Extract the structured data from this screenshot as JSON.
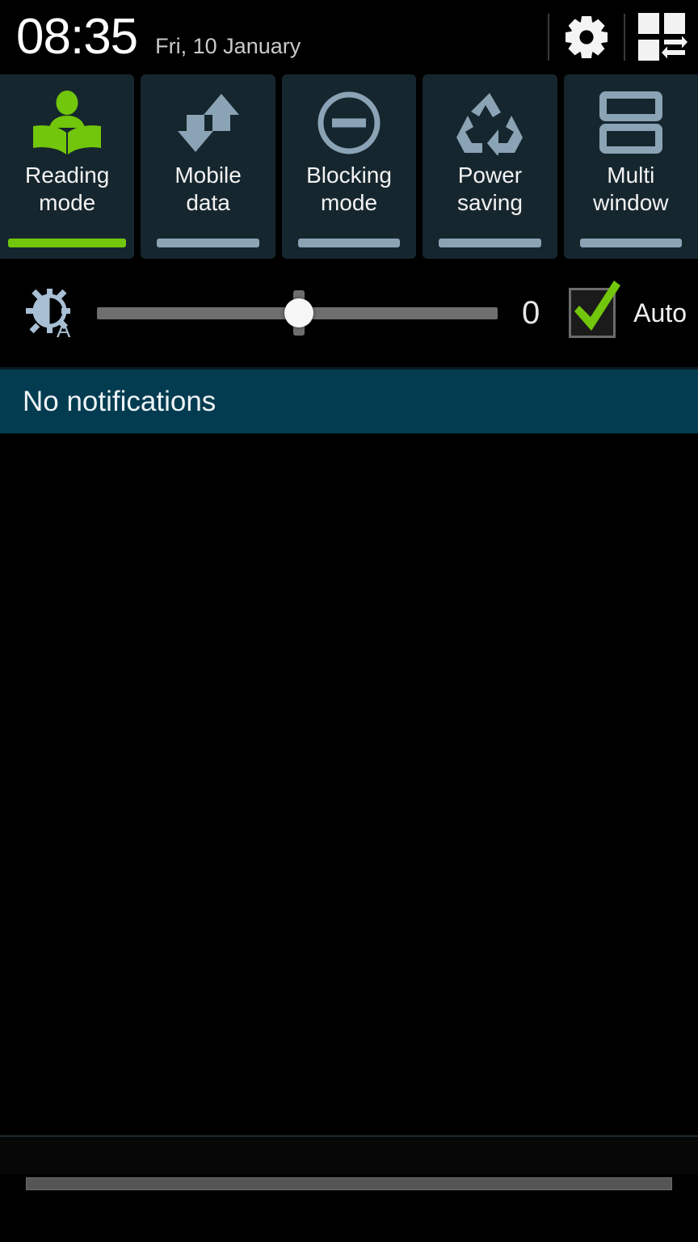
{
  "statusbar": {
    "time": "08:35",
    "date": "Fri, 10 January",
    "settings_icon": "gear-icon",
    "quick_settings_icon": "quick-settings-grid-icon"
  },
  "quick_toggles": [
    {
      "label": "Reading\nmode",
      "label_line1": "Reading",
      "label_line2": "mode",
      "icon": "reading-person-book-icon",
      "state": "on",
      "indicator_color": "#72c60b",
      "icon_color": "#72c60b"
    },
    {
      "label": "Mobile\ndata",
      "label_line1": "Mobile",
      "label_line2": "data",
      "icon": "mobile-data-arrows-icon",
      "state": "off",
      "indicator_color": "#8aa3b5",
      "icon_color": "#8aa3b5"
    },
    {
      "label": "Blocking\nmode",
      "label_line1": "Blocking",
      "label_line2": "mode",
      "icon": "do-not-disturb-circle-icon",
      "state": "off",
      "indicator_color": "#8aa3b5",
      "icon_color": "#8aa3b5"
    },
    {
      "label": "Power\nsaving",
      "label_line1": "Power",
      "label_line2": "saving",
      "icon": "recycle-arrows-icon",
      "state": "off",
      "indicator_color": "#8aa3b5",
      "icon_color": "#8aa3b5"
    },
    {
      "label": "Multi\nwindow",
      "label_line1": "Multi",
      "label_line2": "window",
      "icon": "multi-window-split-icon",
      "state": "off",
      "indicator_color": "#8aa3b5",
      "icon_color": "#8aa3b5"
    }
  ],
  "brightness": {
    "icon": "brightness-auto-icon",
    "value": "0",
    "slider_percent": 50,
    "auto_label": "Auto",
    "auto_checked": true,
    "check_color": "#72c60b",
    "track_color": "#6e6e6e",
    "thumb_color": "#f6f6f6"
  },
  "notifications": {
    "empty_text": "No notifications",
    "bar_color": "#033c50"
  },
  "colors": {
    "background": "#000000",
    "tile_background": "#16262e",
    "accent_green": "#72c60b",
    "icon_grey_blue": "#8aa3b5",
    "text_primary": "#f2f2f2",
    "text_secondary": "#c9c9c9"
  }
}
